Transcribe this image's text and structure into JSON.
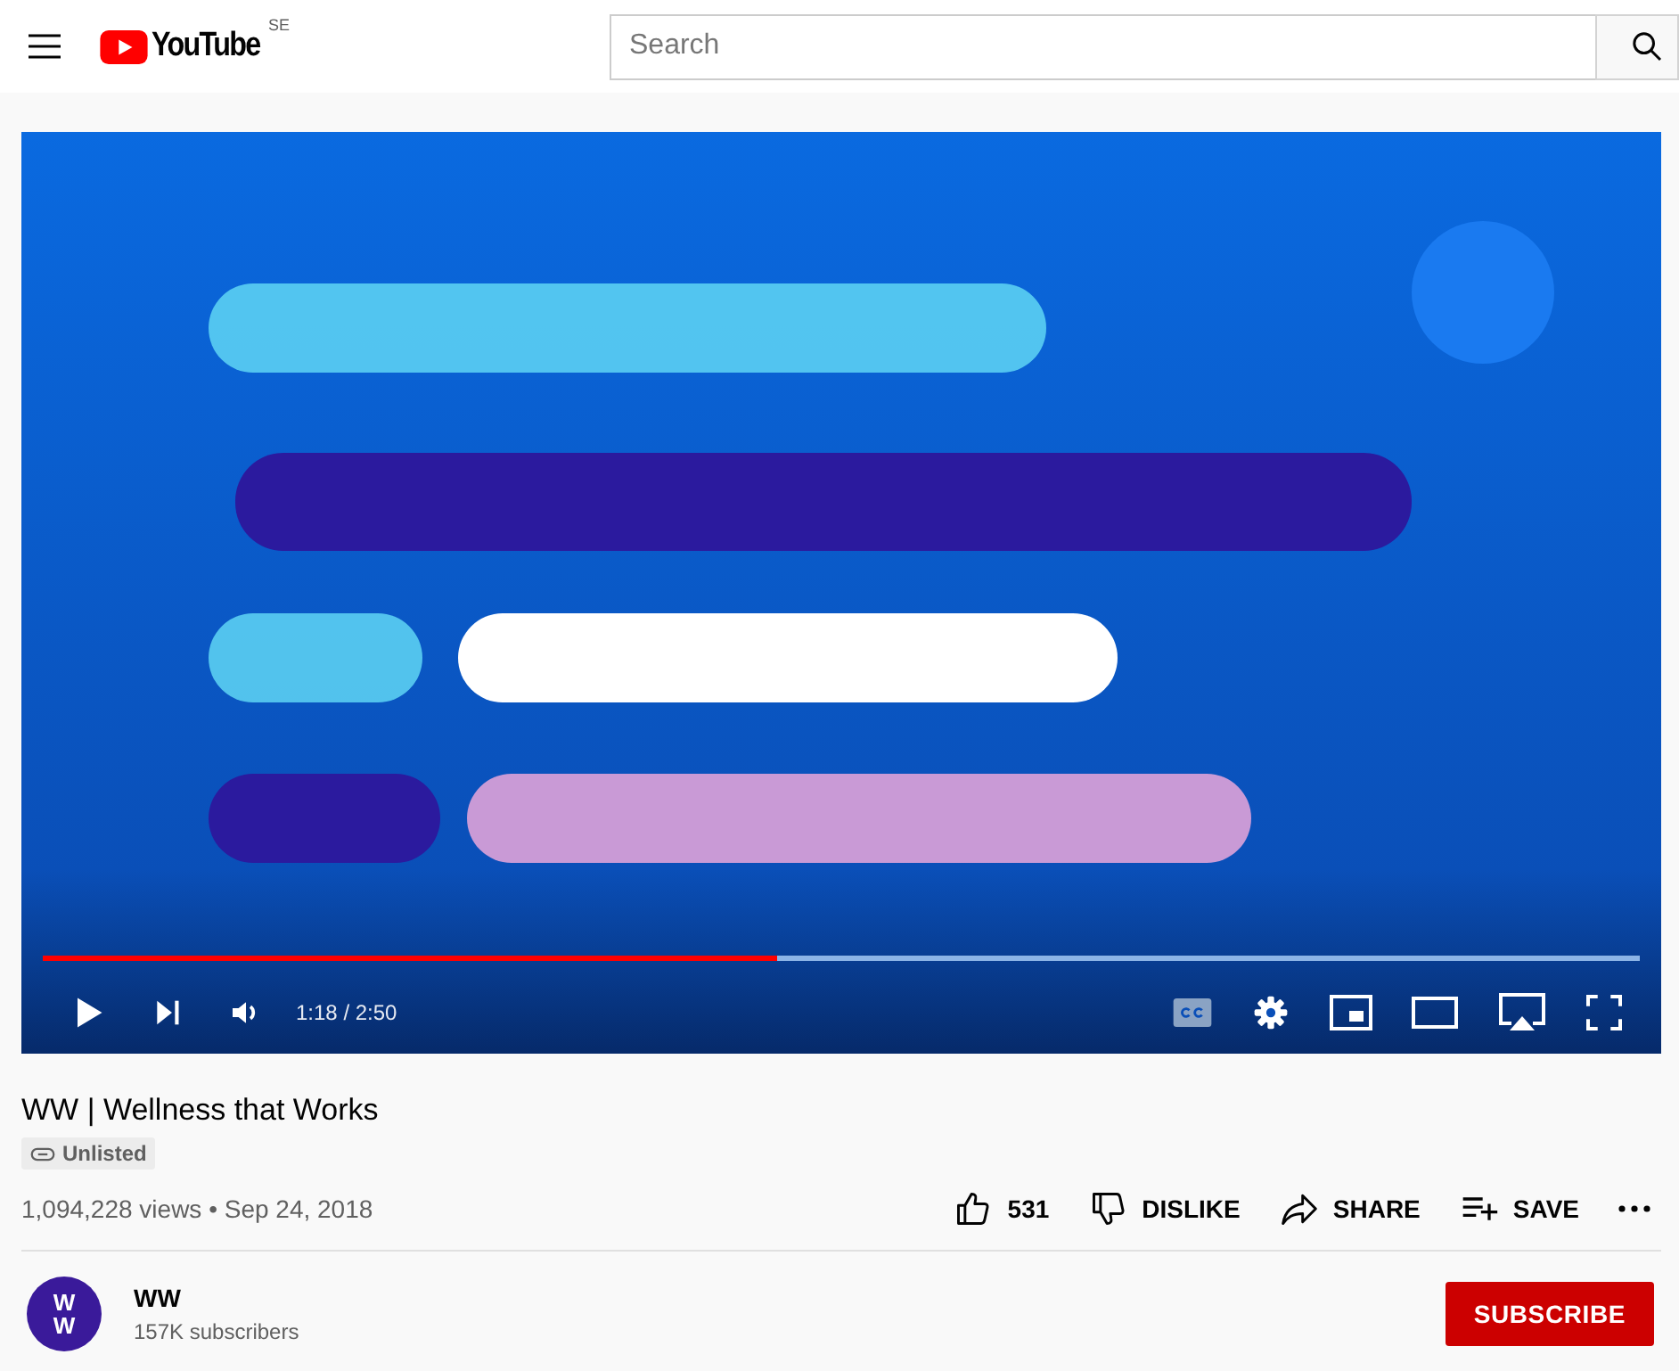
{
  "header": {
    "logo_text": "YouTube",
    "country_code": "SE",
    "search": {
      "placeholder": "Search"
    }
  },
  "player": {
    "progress": {
      "level": 0.46
    },
    "time": "1:18 / 2:50",
    "playing": false
  },
  "video": {
    "title": "WW | Wellness that Works",
    "badge": "Unlisted",
    "stats": "1,094,228 views • Sep 24, 2018",
    "actions": [
      {
        "kind": "like",
        "label": "531"
      },
      {
        "kind": "dislike",
        "label": "DISLIKE"
      },
      {
        "kind": "share",
        "label": "SHARE"
      },
      {
        "kind": "save",
        "label": "SAVE"
      },
      {
        "kind": "more"
      }
    ]
  },
  "channel": {
    "avatar_text": "WW",
    "name": "WW",
    "subscribers": "157K subscribers",
    "subscribe_button": "SUBSCRIBE"
  }
}
